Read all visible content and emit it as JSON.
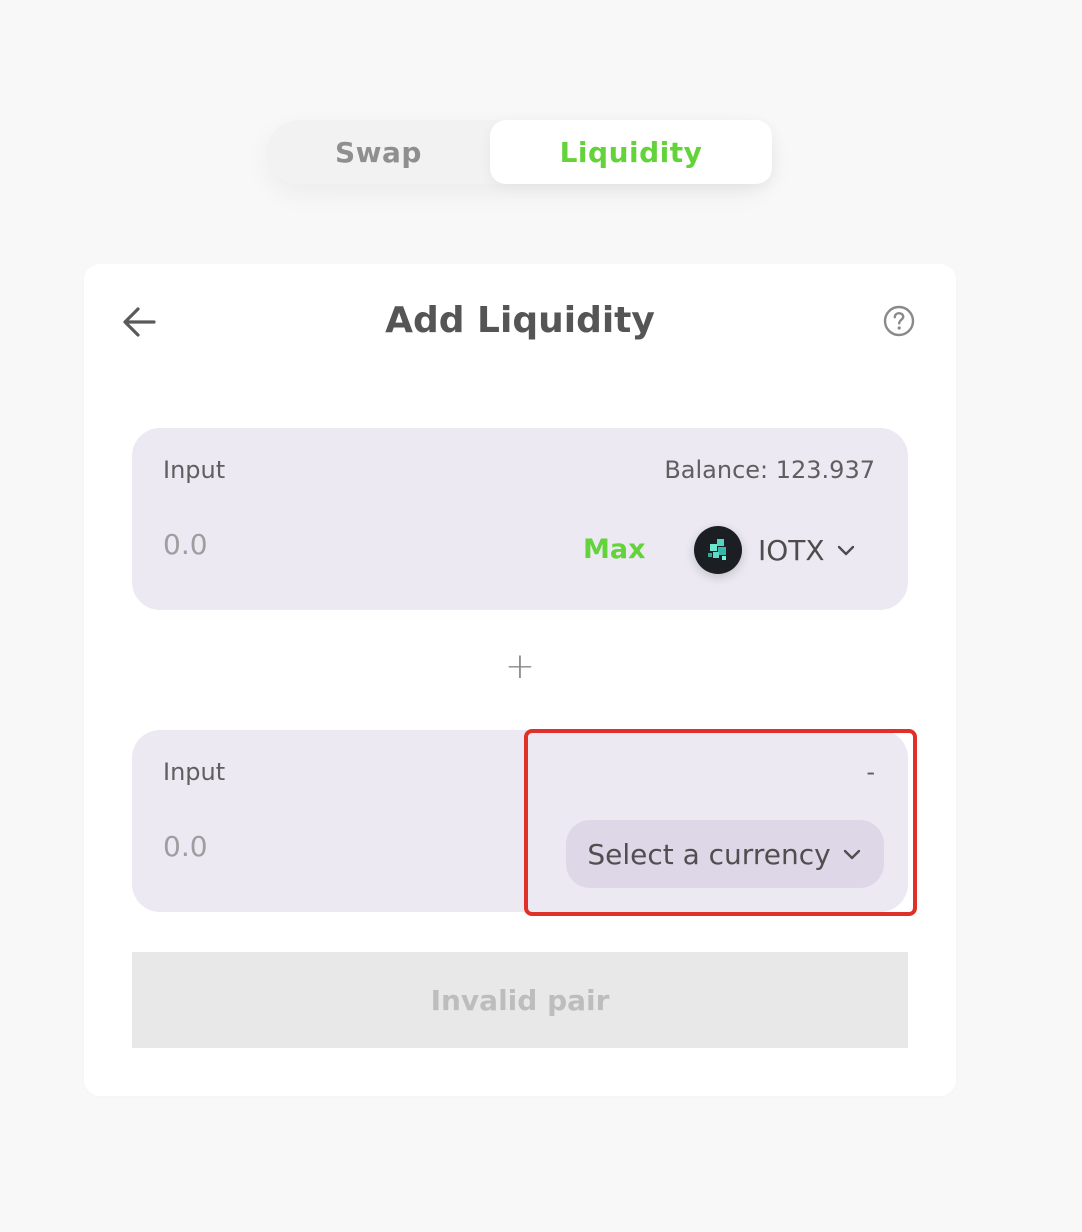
{
  "tabs": [
    {
      "label": "Swap",
      "active": false
    },
    {
      "label": "Liquidity",
      "active": true
    }
  ],
  "card": {
    "title": "Add Liquidity",
    "back_icon": "arrow-left-icon",
    "help_icon": "question-circle-icon"
  },
  "input_a": {
    "label": "Input",
    "balance_text": "Balance: 123.937",
    "amount_placeholder": "0.0",
    "max_label": "Max",
    "token_symbol": "IOTX",
    "token_icon": "iotx-token-logo"
  },
  "plus_sign": "+",
  "input_b": {
    "label": "Input",
    "balance_text": "-",
    "amount_placeholder": "0.0",
    "select_currency_label": "Select a currency"
  },
  "submit": {
    "label": "Invalid pair",
    "disabled": true
  },
  "colors": {
    "accent_green": "#62d339",
    "panel_bg": "#ece9f3",
    "select_button_bg": "#ded7e8",
    "highlight_red": "#e0302a",
    "disabled_button_bg": "#e8e8e9"
  }
}
